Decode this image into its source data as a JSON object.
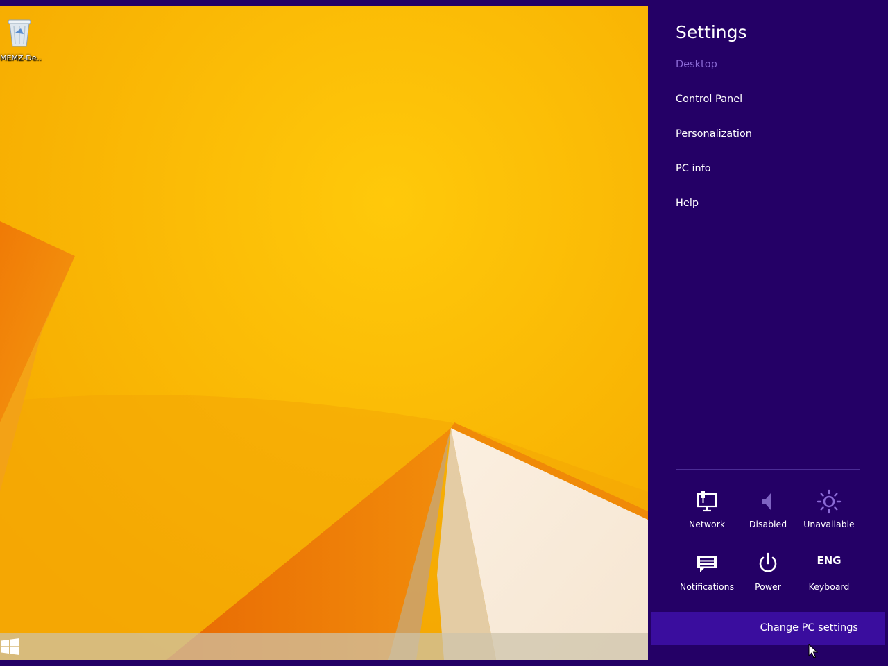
{
  "desktop": {
    "recycle_bin_label": "MEMZ-De...",
    "start_button_icon": "windows-logo-icon"
  },
  "charm": {
    "title": "Settings",
    "subtitle": "Desktop",
    "menu_items": [
      "Control Panel",
      "Personalization",
      "PC info",
      "Help"
    ],
    "tiles": [
      {
        "label": "Network",
        "icon": "network-icon"
      },
      {
        "label": "Disabled",
        "icon": "volume-icon"
      },
      {
        "label": "Unavailable",
        "icon": "brightness-icon"
      },
      {
        "label": "Notifications",
        "icon": "notifications-icon"
      },
      {
        "label": "Power",
        "icon": "power-icon"
      },
      {
        "label": "Keyboard",
        "icon": "keyboard-icon",
        "text": "ENG"
      }
    ],
    "change_pc_settings": "Change PC settings"
  },
  "colors": {
    "charm_background": "#240066",
    "charm_highlight": "#3a0d9e",
    "subtitle": "#8b6ad6",
    "wallpaper": "#f9b800"
  }
}
